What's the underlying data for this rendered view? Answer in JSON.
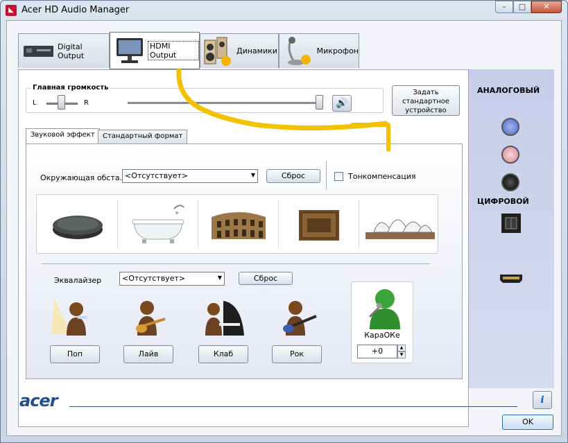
{
  "window": {
    "title": "Acer HD Audio Manager",
    "min": "–",
    "max": "□",
    "close": "✕"
  },
  "tabs": [
    {
      "label": "Digital Output"
    },
    {
      "label": "HDMI Output"
    },
    {
      "label": "Динамики"
    },
    {
      "label": "Микрофон"
    }
  ],
  "volume": {
    "title": "Главная громкость",
    "left": "L",
    "right": "R",
    "mute_icon": "speaker-icon"
  },
  "set_default_label": "Задать стандартное устройство",
  "subtabs": [
    {
      "label": "Звуковой эффект"
    },
    {
      "label": "Стандартный формат"
    }
  ],
  "environment": {
    "label": "Окружающая обста...",
    "value": "<Отсутствует>",
    "reset": "Сброс",
    "loudness_label": "Тонкомпенсация",
    "presets": [
      "stone-icon",
      "bathtub-icon",
      "colosseum-icon",
      "box-icon",
      "opera-house-icon"
    ]
  },
  "equalizer": {
    "label": "Эквалайзер",
    "value": "<Отсутствует>",
    "reset": "Сброс",
    "presets": [
      {
        "label": "Поп"
      },
      {
        "label": "Лайв"
      },
      {
        "label": "Клаб"
      },
      {
        "label": "Рок"
      }
    ]
  },
  "karaoke": {
    "label": "КараОКе",
    "value": "+0"
  },
  "side": {
    "analog": "АНАЛОГОВЫЙ",
    "digital": "ЦИФРОВОЙ",
    "jack_colors": [
      "#5b7ed6",
      "#e8a9b6",
      "#111111"
    ]
  },
  "footer": {
    "logo": "acer",
    "info": "i",
    "ok": "OK"
  },
  "colors": {
    "annotation": "#f2c200",
    "accent": "#1f4f8f"
  }
}
